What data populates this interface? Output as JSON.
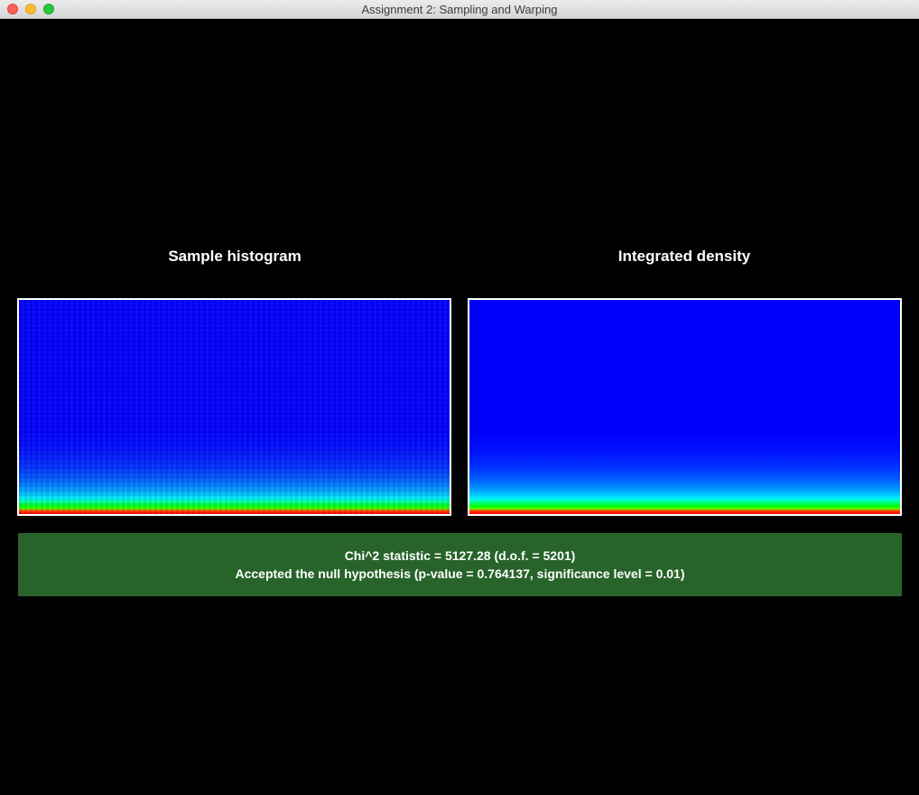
{
  "window": {
    "title": "Assignment 2: Sampling and Warping"
  },
  "panels": {
    "left": {
      "heading": "Sample histogram"
    },
    "right": {
      "heading": "Integrated density"
    }
  },
  "result": {
    "line1": "Chi^2 statistic = 5127.28 (d.o.f. = 5201)",
    "line2": "Accepted the null hypothesis (p-value = 0.764137, significance level = 0.01)",
    "status_color": "#28642a"
  },
  "colors": {
    "background": "#000000",
    "plot_base": "#0000ff",
    "plot_border": "#ffffff"
  }
}
